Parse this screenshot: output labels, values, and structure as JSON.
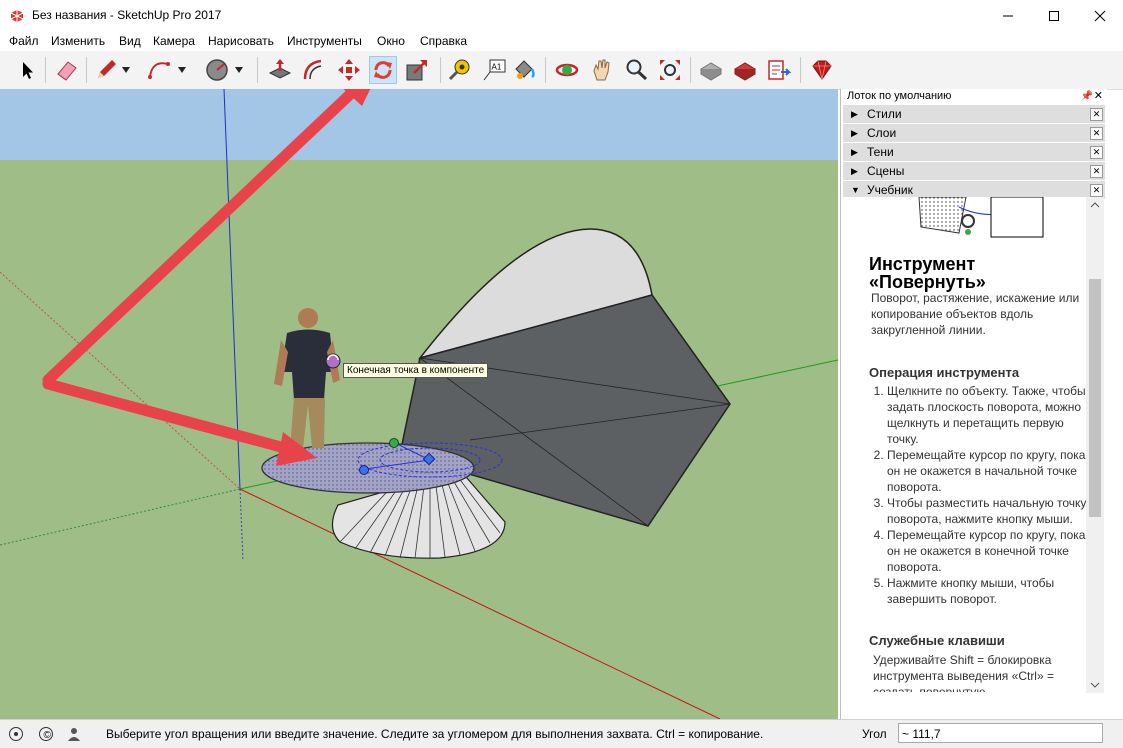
{
  "window": {
    "title": "Без названия - SketchUp Pro 2017",
    "controls": [
      "minimize-icon",
      "maximize-icon",
      "close-icon"
    ]
  },
  "menu": {
    "items": [
      "Файл",
      "Изменить",
      "Вид",
      "Камера",
      "Нарисовать",
      "Инструменты",
      "Окно",
      "Справка"
    ]
  },
  "toolbar": {
    "tools": [
      {
        "name": "select-icon"
      },
      {
        "name": "eraser-icon"
      },
      {
        "name": "pencil-icon"
      },
      {
        "name": "arc-icon"
      },
      {
        "name": "circle-icon"
      },
      {
        "name": "push-pull-icon"
      },
      {
        "name": "offset-icon"
      },
      {
        "name": "move-icon"
      },
      {
        "name": "rotate-icon",
        "active": true
      },
      {
        "name": "scale-icon"
      },
      {
        "name": "tape-measure-icon"
      },
      {
        "name": "text-icon",
        "text": "A1"
      },
      {
        "name": "paint-bucket-icon"
      },
      {
        "name": "orbit-icon"
      },
      {
        "name": "pan-icon"
      },
      {
        "name": "zoom-icon"
      },
      {
        "name": "zoom-extents-icon"
      },
      {
        "name": "warehouse-icon"
      },
      {
        "name": "extension-warehouse-icon"
      },
      {
        "name": "send-to-layout-icon"
      },
      {
        "name": "ruby-icon"
      }
    ]
  },
  "viewport": {
    "sky_color": "#a3c5e6",
    "ground_color": "#9fbe87",
    "tooltip": "Конечная точка в компоненте"
  },
  "tray": {
    "title": "Лоток по умолчанию",
    "panels": [
      {
        "label": "Стили",
        "expanded": false
      },
      {
        "label": "Слои",
        "expanded": false
      },
      {
        "label": "Тени",
        "expanded": false
      },
      {
        "label": "Сцены",
        "expanded": false
      },
      {
        "label": "Учебник",
        "expanded": true
      }
    ],
    "help": {
      "heading": "Инструмент «Повернуть»",
      "description": "Поворот, растяжение, искажение или копирование объектов вдоль закругленной линии.",
      "operation_heading": "Операция инструмента",
      "steps": [
        "Щелкните по объекту. Также, чтобы задать плоскость поворота, можно щелкнуть и перетащить первую точку.",
        "Перемещайте курсор по кругу, пока он не окажется в начальной точке поворота.",
        "Чтобы разместить начальную точку поворота, нажмите кнопку мыши.",
        "Перемещайте курсор по кругу, пока он не окажется в конечной точке поворота.",
        "Нажмите кнопку мыши, чтобы завершить поворот."
      ],
      "keys_heading": "Служебные клавиши",
      "keys_text": "Удерживайте Shift = блокировка инструмента выведения «Ctrl» = создать повернутую"
    }
  },
  "status": {
    "message": "Выберите угол вращения или введите значение.  Следите за угломером для выполнения захвата. Ctrl = копирование.",
    "angle_label": "Угол",
    "angle_value": "~ 111,7"
  },
  "colors": {
    "arrow_red": "#e8434b",
    "rotate_icon_red": "#e03c31"
  }
}
